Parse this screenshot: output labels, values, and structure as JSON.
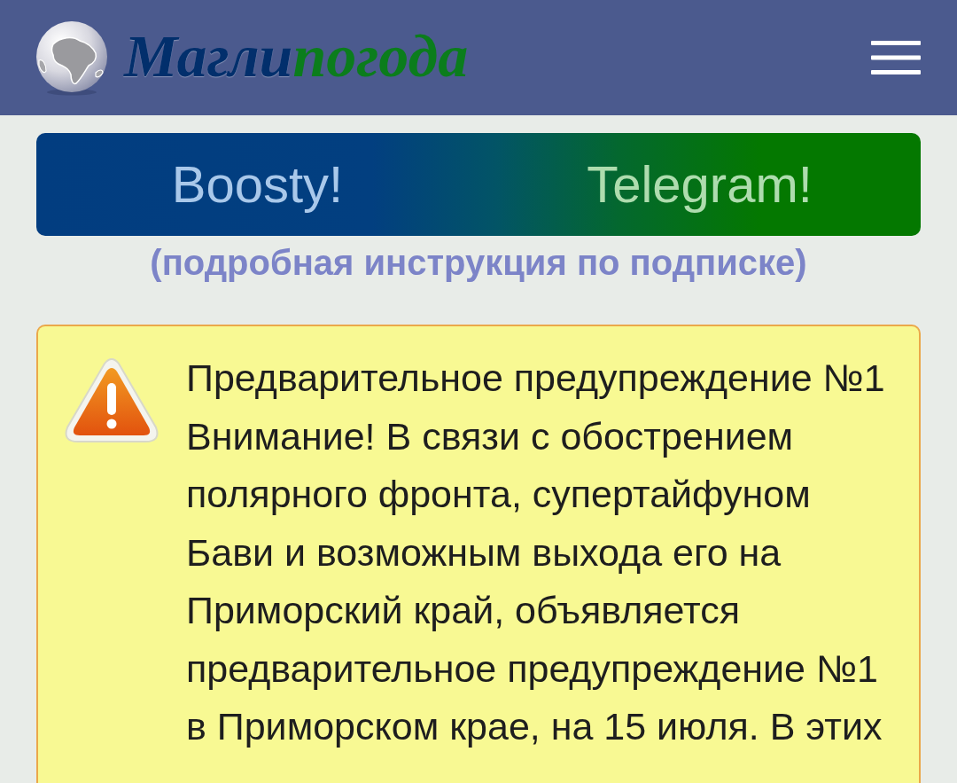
{
  "header": {
    "logo": {
      "part_1": "Магли",
      "part_2": "погода"
    }
  },
  "subscribe": {
    "links": [
      "Boosty!",
      "Telegram!"
    ],
    "instructions": "(подробная инструкция по подписке)"
  },
  "alert": {
    "title": "Предварительное предупреждение №1",
    "text": "Внимание! В связи с обострением полярного фронта, супертайфуном Бави и возможным выхода его на Приморский край, объявляется предварительное предупреждение №1 в Приморском крае, на 15 июля. В этих"
  }
}
